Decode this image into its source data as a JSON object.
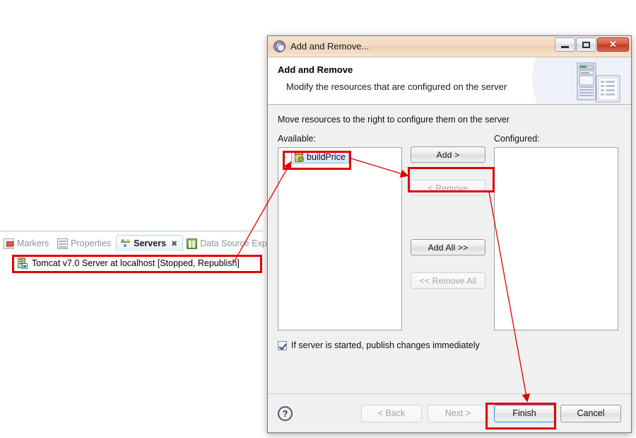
{
  "workbench": {
    "tabs": [
      {
        "label": "Markers",
        "icon": "markers-icon",
        "active": false
      },
      {
        "label": "Properties",
        "icon": "properties-icon",
        "active": false
      },
      {
        "label": "Servers",
        "icon": "servers-icon",
        "active": true,
        "close": "✖"
      },
      {
        "label": "Data Source Explorer",
        "icon": "data-source-explorer-icon",
        "active": false
      }
    ],
    "server_row": {
      "icon": "tomcat-server-icon",
      "label": "Tomcat v7.0 Server at localhost  [Stopped, Republish]"
    }
  },
  "dialog": {
    "title": "Add and Remove...",
    "title_icon": "gear-icon",
    "window_buttons": {
      "minimize": "minimize-icon",
      "maximize": "maximize-icon",
      "close": "✕"
    },
    "banner": {
      "title": "Add and Remove",
      "subtitle": "Modify the resources that are configured on the server",
      "art": "server-and-document-icon"
    },
    "instruction": "Move resources to the right to configure them on the server",
    "available": {
      "label": "Available:",
      "items": [
        {
          "label": "buildPrice",
          "icon": "web-project-icon",
          "selected": true,
          "expandable": true
        }
      ]
    },
    "configured": {
      "label": "Configured:",
      "items": []
    },
    "transfer_buttons": [
      {
        "label": "Add >",
        "enabled": true
      },
      {
        "label": "< Remove",
        "enabled": false
      },
      {
        "label": "Add All >>",
        "enabled": true
      },
      {
        "label": "<< Remove All",
        "enabled": false
      }
    ],
    "checkbox": {
      "label": "If server is started, publish changes immediately",
      "checked": true
    },
    "footer": {
      "help": "?",
      "buttons": [
        {
          "label": "< Back",
          "enabled": false,
          "default": false
        },
        {
          "label": "Next >",
          "enabled": false,
          "default": false
        },
        {
          "label": "Finish",
          "enabled": true,
          "default": true
        },
        {
          "label": "Cancel",
          "enabled": true,
          "default": false
        }
      ]
    }
  },
  "annotations": {
    "color": "#e00000",
    "highlight_boxes": [
      "server-row-highlight",
      "available-item-highlight",
      "add-button-highlight",
      "finish-button-highlight"
    ],
    "arrows": [
      "server-row-to-available-item",
      "available-item-to-add-button",
      "add-button-to-finish-button"
    ]
  }
}
